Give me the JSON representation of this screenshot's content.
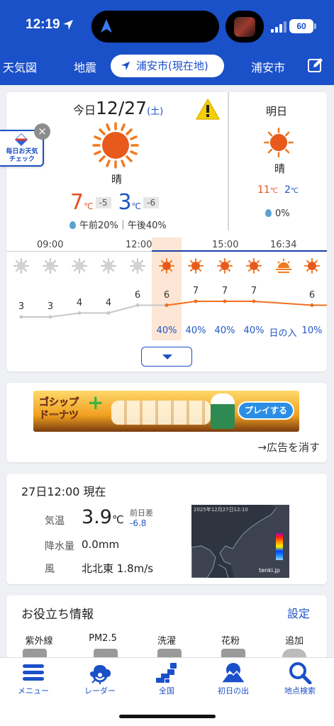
{
  "status_bar": {
    "time": "12:19",
    "battery": "60"
  },
  "nav": {
    "items": [
      "天気図",
      "地震",
      "浦安市(現在地)",
      "浦安市"
    ],
    "active_index": 2
  },
  "today": {
    "date_prefix": "今日",
    "date": "12/27",
    "dow": "(土)",
    "condition": "晴",
    "high": "7",
    "high_diff": "-5",
    "low": "3",
    "low_diff": "-6",
    "unit": "℃",
    "rain": "午前20%｜午後40%"
  },
  "tomorrow": {
    "label": "明日",
    "condition": "晴",
    "high": "11",
    "low": "2",
    "unit": "℃",
    "rain": "0%"
  },
  "mainichi_badge": {
    "line1": "毎日お天気",
    "line2": "チェック"
  },
  "timeline": {
    "time_labels": [
      "09:00",
      "12:00",
      "15:00",
      "16:34"
    ],
    "hours": [
      {
        "icon": "sun-grey-icon",
        "temp": "3",
        "pop": ""
      },
      {
        "icon": "sun-grey-icon",
        "temp": "3",
        "pop": ""
      },
      {
        "icon": "sun-grey-icon",
        "temp": "4",
        "pop": ""
      },
      {
        "icon": "sun-grey-icon",
        "temp": "4",
        "pop": ""
      },
      {
        "icon": "sun-grey-icon",
        "temp": "6",
        "pop": ""
      },
      {
        "icon": "sun-icon",
        "temp": "6",
        "pop": "40%"
      },
      {
        "icon": "sun-icon",
        "temp": "7",
        "pop": "40%"
      },
      {
        "icon": "sun-icon",
        "temp": "7",
        "pop": "40%"
      },
      {
        "icon": "sun-icon",
        "temp": "7",
        "pop": "40%"
      },
      {
        "icon": "sunset-icon",
        "temp": "",
        "pop": "日の入"
      },
      {
        "icon": "sun-icon",
        "temp": "6",
        "pop": "10%"
      }
    ],
    "current_index": 5,
    "colors": {
      "past": "#c8c8c8",
      "future": "#f07020",
      "highlight": "#fde6d5"
    }
  },
  "ad": {
    "title_line1": "ゴシップ",
    "title_line2": "ドーナツ",
    "play_label": "プレイする",
    "remove_label": "→広告を消す"
  },
  "now": {
    "title": "27日12:00 現在",
    "rows": [
      {
        "label": "気温",
        "value": "3.9",
        "unit": "℃"
      },
      {
        "label": "降水量",
        "value": "0.0mm"
      },
      {
        "label": "風",
        "value": "北北東 1.8m/s"
      }
    ],
    "yesterday_label": "前日差",
    "yesterday_diff": "-6.8",
    "radar_caption": "2025年12月27日12:10",
    "radar_logo": "tenki.jp"
  },
  "useful_info": {
    "title": "お役立ち情報",
    "settings_label": "設定",
    "items": [
      "紫外線",
      "PM2.5",
      "洗濯",
      "花粉",
      "追加"
    ]
  },
  "tabbar": {
    "items": [
      {
        "label": "メニュー",
        "icon": "menu-icon"
      },
      {
        "label": "レーダー",
        "icon": "radar-icon"
      },
      {
        "label": "全国",
        "icon": "japan-map-icon"
      },
      {
        "label": "初日の出",
        "icon": "sunrise-icon"
      },
      {
        "label": "地点検索",
        "icon": "search-icon"
      }
    ]
  },
  "colors": {
    "brand": "#1a50c8",
    "hot": "#e5521f",
    "cold": "#2255c4"
  }
}
